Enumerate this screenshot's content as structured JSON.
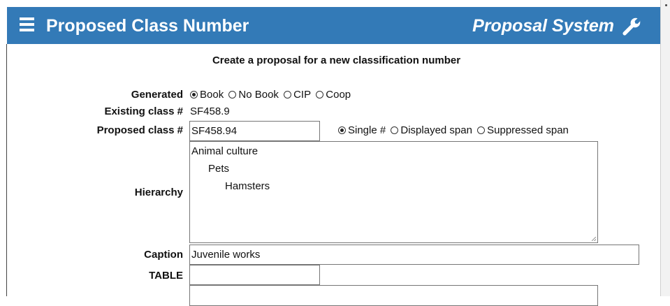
{
  "header": {
    "title": "Proposed Class Number",
    "system_name": "Proposal System",
    "menu_icon": "hamburger-menu-icon",
    "settings_icon": "wrench-icon",
    "color": "#337ab7"
  },
  "subtitle": "Create a proposal for a new classification number",
  "form": {
    "generated": {
      "label": "Generated",
      "options": [
        "Book",
        "No Book",
        "CIP",
        "Coop"
      ],
      "selected": "Book"
    },
    "existing_class": {
      "label": "Existing class #",
      "value": "SF458.9"
    },
    "proposed_class": {
      "label": "Proposed class #",
      "value": "SF458.94",
      "type_options": [
        "Single #",
        "Displayed span",
        "Suppressed span"
      ],
      "type_selected": "Single #"
    },
    "hierarchy": {
      "label": "Hierarchy",
      "lines": [
        "Animal culture",
        "Pets",
        "Hamsters"
      ]
    },
    "caption": {
      "label": "Caption",
      "value": "Juvenile works"
    },
    "table": {
      "label": "TABLE",
      "value": ""
    }
  }
}
